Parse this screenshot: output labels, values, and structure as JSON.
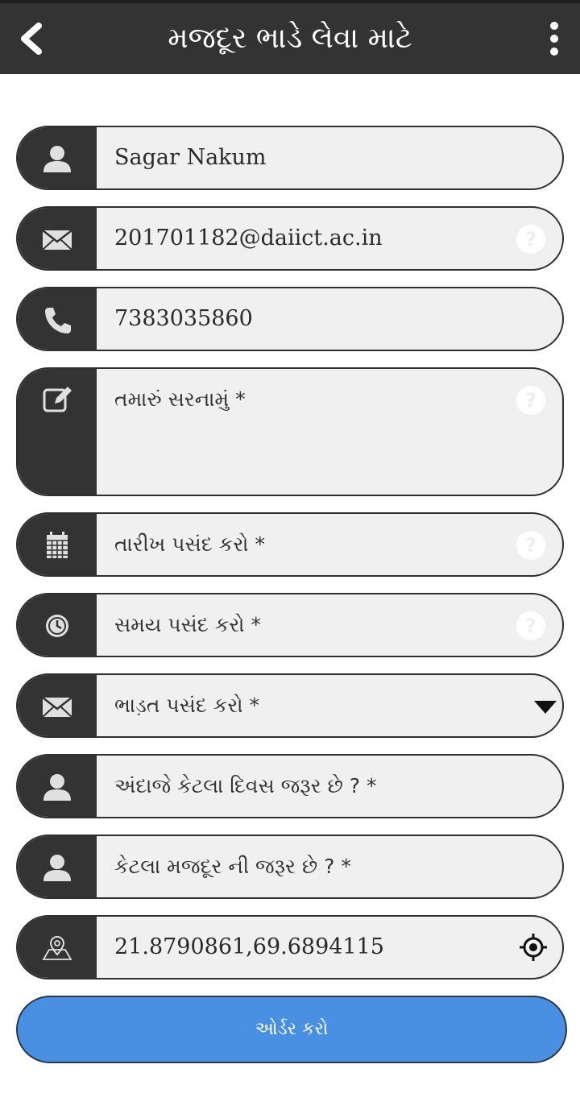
{
  "header": {
    "title": "મજદૂર ભાડે લેવા માટે",
    "back_icon": "chevron-left-icon",
    "menu_icon": "more-vertical-icon"
  },
  "form": {
    "name_value": "Sagar Nakum",
    "email_value": "201701182@daiict.ac.in",
    "phone_value": "7383035860",
    "address_placeholder": "તમારું સરનામું *",
    "date_placeholder": "તારીખ પસંદ કરો *",
    "time_placeholder": "સમય પસંદ કરો *",
    "fare_selected": " ભાડ઼ત પસંદ કરો *",
    "days_placeholder": "અંદાજે કેટલા દિવસ  જરૂર છે ? *",
    "workers_placeholder": "કેટલા મજદૂર ની જરૂર છે ? *",
    "location_value": "21.8790861,69.6894115",
    "submit_label": "ઓર્ડર કરો"
  },
  "colors": {
    "appbar": "#333333",
    "icon_box": "#333333",
    "field_bg": "#f0f0f0",
    "button": "#4a90e2"
  }
}
